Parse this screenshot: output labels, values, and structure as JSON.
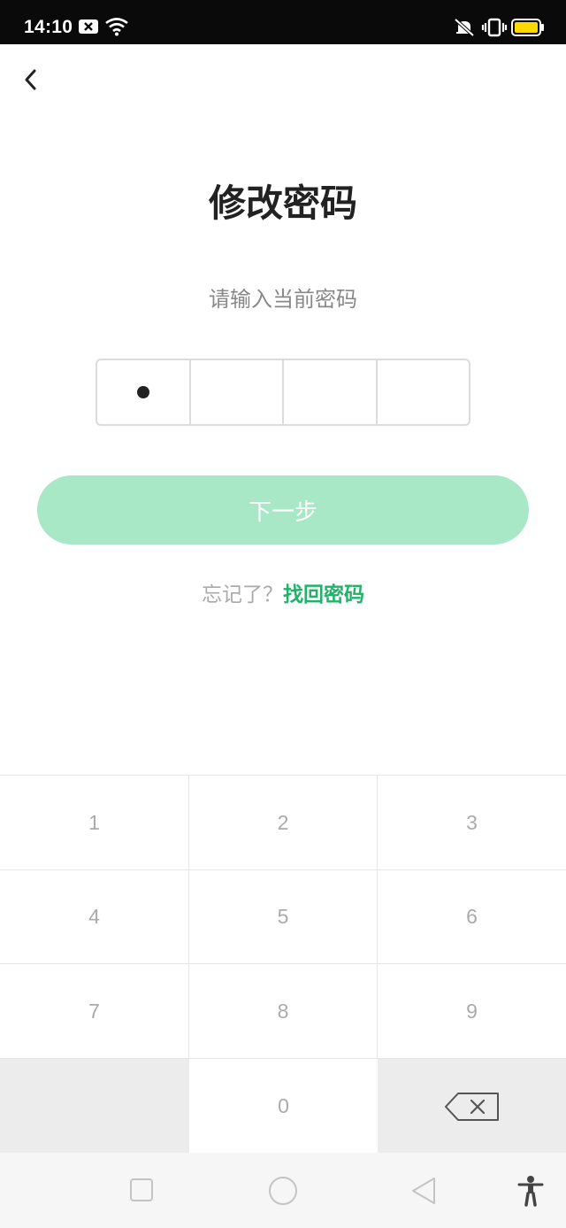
{
  "status_bar": {
    "time": "14:10",
    "icons": [
      "notification-x-icon",
      "wifi-icon",
      "mute-vibrate-icon",
      "vibrate-icon",
      "battery-icon"
    ],
    "battery_color": "#ffd800"
  },
  "header": {
    "back_icon": "chevron-left-icon"
  },
  "main": {
    "title": "修改密码",
    "prompt": "请输入当前密码",
    "pin": {
      "length": 4,
      "filled": 1,
      "cells": [
        "•",
        "",
        "",
        ""
      ]
    },
    "next_button_label": "下一步",
    "forgot_text": "忘记了？",
    "retrieve_link": "找回密码"
  },
  "keypad": {
    "keys": [
      "1",
      "2",
      "3",
      "4",
      "5",
      "6",
      "7",
      "8",
      "9",
      "",
      "0",
      ""
    ],
    "delete_icon": "backspace-icon"
  },
  "nav_bar": {
    "buttons": [
      "recents-square-icon",
      "home-circle-icon",
      "back-triangle-icon",
      "accessibility-icon"
    ]
  },
  "colors": {
    "accent_green": "#22b36a",
    "button_disabled_green": "#a8e8c6",
    "text_dark": "#222222",
    "text_gray": "#888888"
  }
}
